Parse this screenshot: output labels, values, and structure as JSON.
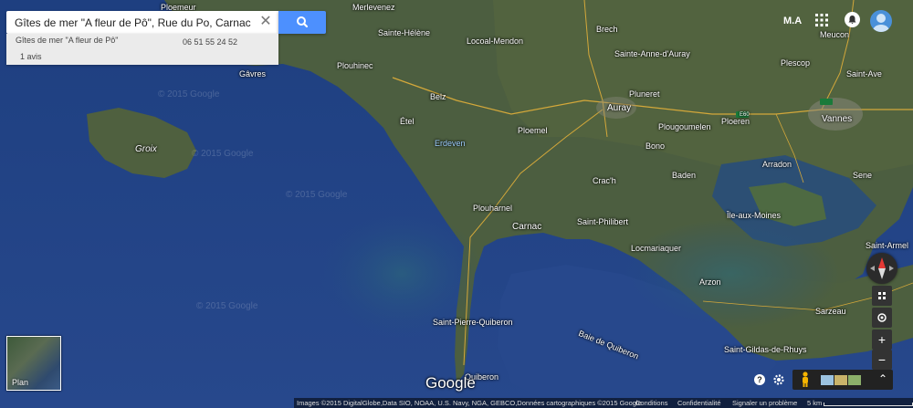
{
  "search": {
    "query": "Gîtes de mer \"A fleur de Pô\", Rue du Po, Carnac",
    "clear_symbol": "✕"
  },
  "result": {
    "name": "Gîtes de mer \"A fleur de Pô\"",
    "phone": "06 51 55 24 52",
    "reviews": "1 avis"
  },
  "account": {
    "name": "M.A"
  },
  "map": {
    "places": [
      "Ploemeur",
      "Merlevenez",
      "Brech",
      "Sainte-Hélène",
      "Locoal-Mendon",
      "Meucon",
      "Gâvres",
      "Plouhinec",
      "Sainte-Anne-d'Auray",
      "Plescop",
      "Saint-Ave",
      "Belz",
      "Pluneret",
      "Auray",
      "Étel",
      "Plougoumelen",
      "Ploeren",
      "Vannes",
      "Erdeven",
      "Ploemel",
      "Bono",
      "Groix",
      "Arradon",
      "Baden",
      "Sene",
      "Crac'h",
      "Plouharnel",
      "Carnac",
      "Saint-Philibert",
      "Île-aux-Moines",
      "Locmariaquer",
      "Saint-Armel",
      "Arzon",
      "Sarzeau",
      "Saint-Pierre-Quiberon",
      "Saint-Gildas-de-Rhuys",
      "Baie de Quiberon",
      "Quiberon"
    ],
    "highway": "E60",
    "watermark": "© 2015 Google",
    "ocean": "#22448a",
    "land": "#4a5d3e"
  },
  "controls": {
    "plan_label": "Plan",
    "zoom_in": "+",
    "zoom_out": "−",
    "help": "?",
    "logo": "Google",
    "expand": "⌃"
  },
  "footer": {
    "attribution": "Images ©2015 DigitalGlobe,Data SIO, NOAA, U.S. Navy, NGA, GEBCO,Données cartographiques ©2015 Google",
    "conditions": "Conditions",
    "privacy": "Confidentialité",
    "report": "Signaler un problème",
    "scale": "5 km"
  }
}
